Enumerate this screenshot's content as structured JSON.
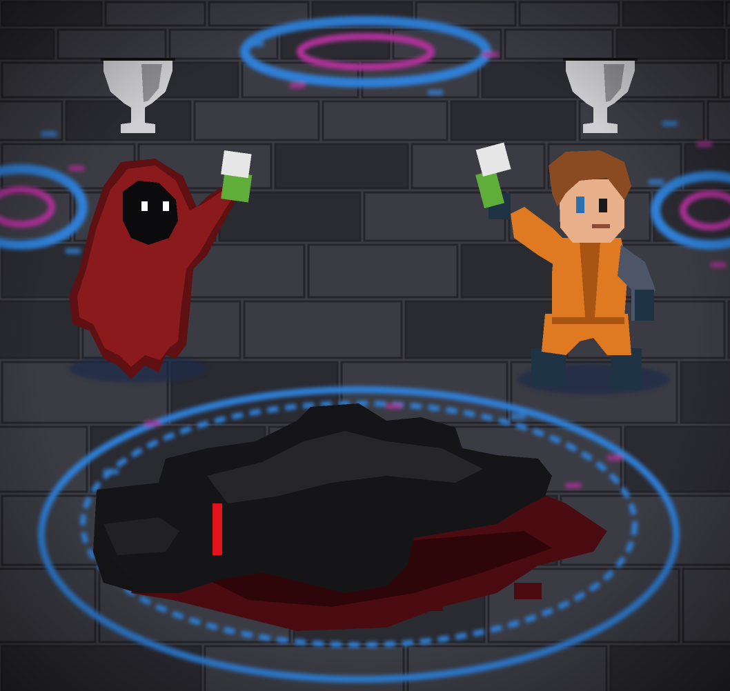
{
  "scene": {
    "floor_color": "#3b3b43",
    "floor_dark": "#2a2a31",
    "mortar_color": "#24242a",
    "rune_blue": "#2f7fd6",
    "rune_magenta": "#b0309a",
    "blood_color": "#4a0c10",
    "blood_dark": "#2e0508"
  },
  "characters": {
    "hooded_figure": {
      "robe_color": "#8a1a1c",
      "robe_shadow": "#5e1012",
      "face_color": "#0b0b0d",
      "eye_color": "#ffffff"
    },
    "survivor": {
      "jacket_color": "#e07a22",
      "jacket_shadow": "#a85514",
      "hair_color": "#8a4a22",
      "skin_color": "#e8b08a",
      "sleeve_color": "#4d5566",
      "pants_color": "#1e3344"
    },
    "fallen_body": {
      "color": "#151517",
      "highlight": "#2a2a2d",
      "wound_color": "#e0141a"
    }
  },
  "items": {
    "trophy_color": "#cfcfd2",
    "trophy_shadow": "#8e8e93",
    "bottle_glass": "#5fae3a",
    "bottle_label": "#e6e6e6"
  }
}
